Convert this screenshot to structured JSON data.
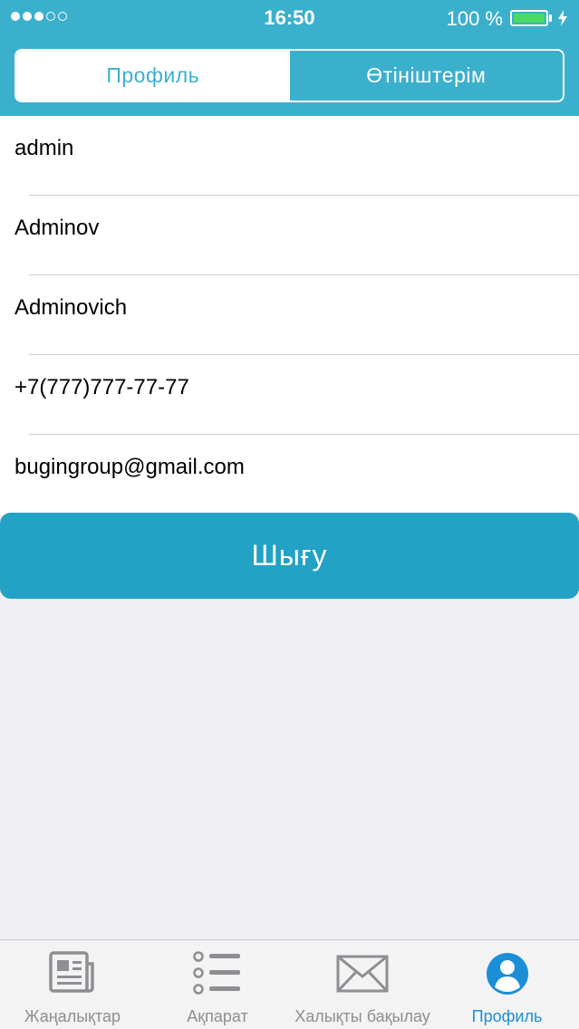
{
  "status_bar": {
    "time": "16:50",
    "battery_percent": "100 %",
    "signal_strength": 3,
    "signal_max": 5,
    "battery_level": 1.0,
    "battery_color": "#4cd964"
  },
  "segmented_control": {
    "tabs": [
      {
        "label": "Профиль",
        "selected": true
      },
      {
        "label": "Өтініштерім",
        "selected": false
      }
    ]
  },
  "profile_fields": [
    {
      "value": "admin"
    },
    {
      "value": "Adminov"
    },
    {
      "value": "Adminovich"
    },
    {
      "value": "+7(777)777-77-77"
    },
    {
      "value": "bugingroup@gmail.com"
    }
  ],
  "logout_button": {
    "label": "Шығу"
  },
  "tab_bar": {
    "items": [
      {
        "label": "Жаңалықтар",
        "icon": "newspaper-icon",
        "selected": false
      },
      {
        "label": "Ақпарат",
        "icon": "list-icon",
        "selected": false
      },
      {
        "label": "Халықты бақылау",
        "icon": "envelope-icon",
        "selected": false
      },
      {
        "label": "Профиль",
        "icon": "person-icon",
        "selected": true
      }
    ]
  },
  "colors": {
    "header": "#3bb0cc",
    "button": "#22a2c4",
    "tab_active": "#1a8fd8",
    "tab_inactive": "#8e8e93",
    "background": "#efeff4"
  }
}
